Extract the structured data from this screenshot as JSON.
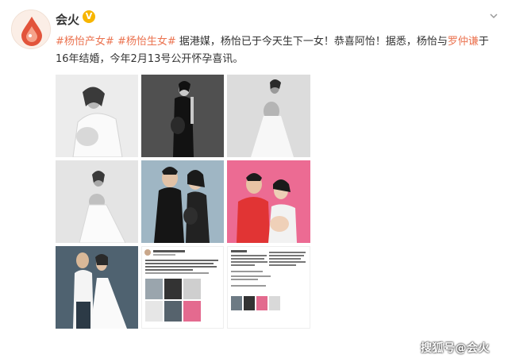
{
  "post": {
    "username": "会火",
    "verified_badge": "V",
    "menu_icon": "chevron-down-icon",
    "tags": [
      "#杨怡产女#",
      "#杨怡生女#"
    ],
    "text_part1": "据港媒，杨怡已于今天生下一女！恭喜阿怡！据悉，杨怡与",
    "mention": "罗仲谦",
    "text_part2": "于",
    "text_line2": "16年结婚，今年2月13号公开怀孕喜讯。",
    "link_color": "#eb7350"
  },
  "photos": [
    {
      "name": "photo-1",
      "desc_icon": "image-icon"
    },
    {
      "name": "photo-2",
      "desc_icon": "image-icon"
    },
    {
      "name": "photo-3",
      "desc_icon": "image-icon"
    },
    {
      "name": "photo-4",
      "desc_icon": "image-icon"
    },
    {
      "name": "photo-5",
      "desc_icon": "image-icon"
    },
    {
      "name": "photo-6",
      "desc_icon": "image-icon"
    },
    {
      "name": "photo-7",
      "desc_icon": "image-icon"
    },
    {
      "name": "photo-8",
      "desc_icon": "image-icon"
    },
    {
      "name": "photo-9",
      "desc_icon": "image-icon"
    }
  ],
  "screenshot8": {
    "handle": "杨怡Tavia Yeung",
    "stamp": "0",
    "meta": "17-8-20 来自 iPhone X",
    "caption1": "一直很想，跟着记录好你的人生，这种心情可以化成文字",
    "caption2": "谢谢大家的支持和关心"
  },
  "watermark": "搜狐号@会火"
}
